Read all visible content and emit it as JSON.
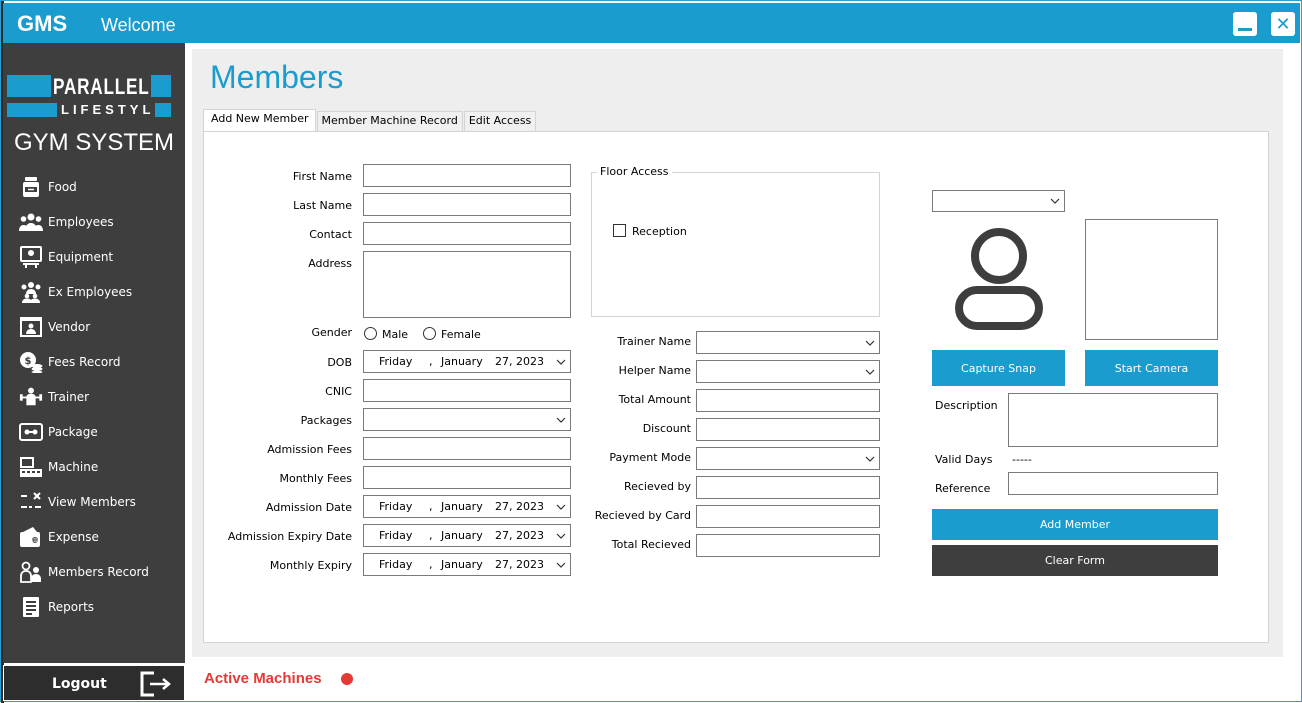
{
  "titlebar": {
    "app_name": "GMS",
    "welcome": "Welcome"
  },
  "sidebar": {
    "logo_top": "PARALLEL",
    "logo_bottom": "LIFESTYLE",
    "system_name": "GYM SYSTEM",
    "items": [
      {
        "label": "Food",
        "icon": "food-jar-icon"
      },
      {
        "label": "Employees",
        "icon": "employees-group-icon"
      },
      {
        "label": "Equipment",
        "icon": "equipment-icon"
      },
      {
        "label": "Ex Employees",
        "icon": "ex-employees-icon"
      },
      {
        "label": "Vendor",
        "icon": "vendor-icon"
      },
      {
        "label": "Fees Record",
        "icon": "coins-icon"
      },
      {
        "label": "Trainer",
        "icon": "trainer-icon"
      },
      {
        "label": "Package",
        "icon": "package-icon"
      },
      {
        "label": "Machine",
        "icon": "machine-icon"
      },
      {
        "label": "View Members",
        "icon": "view-members-icon"
      },
      {
        "label": "Expense",
        "icon": "wallet-icon"
      },
      {
        "label": "Members Record",
        "icon": "members-record-icon"
      },
      {
        "label": "Reports",
        "icon": "reports-icon"
      }
    ],
    "logout": "Logout"
  },
  "main": {
    "title": "Members",
    "tabs": [
      {
        "label": "Add New Member",
        "active": true
      },
      {
        "label": "Member Machine Record",
        "active": false
      },
      {
        "label": "Edit Access",
        "active": false
      }
    ]
  },
  "form": {
    "first_name": "First Name",
    "last_name": "Last Name",
    "contact": "Contact",
    "address": "Address",
    "gender": "Gender",
    "gender_male": "Male",
    "gender_female": "Female",
    "dob": "DOB",
    "cnic": "CNIC",
    "packages": "Packages",
    "admission_fees": "Admission Fees",
    "monthly_fees": "Monthly Fees",
    "admission_date": "Admission Date",
    "admission_expiry_date": "Admission Expiry Date",
    "monthly_expiry": "Monthly Expiry",
    "date_day": "Friday",
    "date_comma": ",",
    "date_month": "January",
    "date_daynum_year": "27, 2023",
    "floor_access": "Floor Access",
    "reception": "Reception",
    "trainer_name": "Trainer Name",
    "helper_name": "Helper Name",
    "total_amount": "Total Amount",
    "discount": "Discount",
    "payment_mode": "Payment Mode",
    "recieved_by": "Recieved by",
    "recieved_by_card": "Recieved by Card",
    "total_recieved": "Total Recieved",
    "capture_snap": "Capture Snap",
    "start_camera": "Start Camera",
    "description": "Description",
    "valid_days": "Valid Days",
    "valid_days_value": "-----",
    "reference": "Reference",
    "add_member": "Add Member",
    "clear_form": "Clear Form"
  },
  "footer": {
    "active_machines": "Active Machines",
    "status_color": "#e53935"
  },
  "colors": {
    "accent": "#1b9ccf",
    "sidebar": "#3e3e3e"
  }
}
